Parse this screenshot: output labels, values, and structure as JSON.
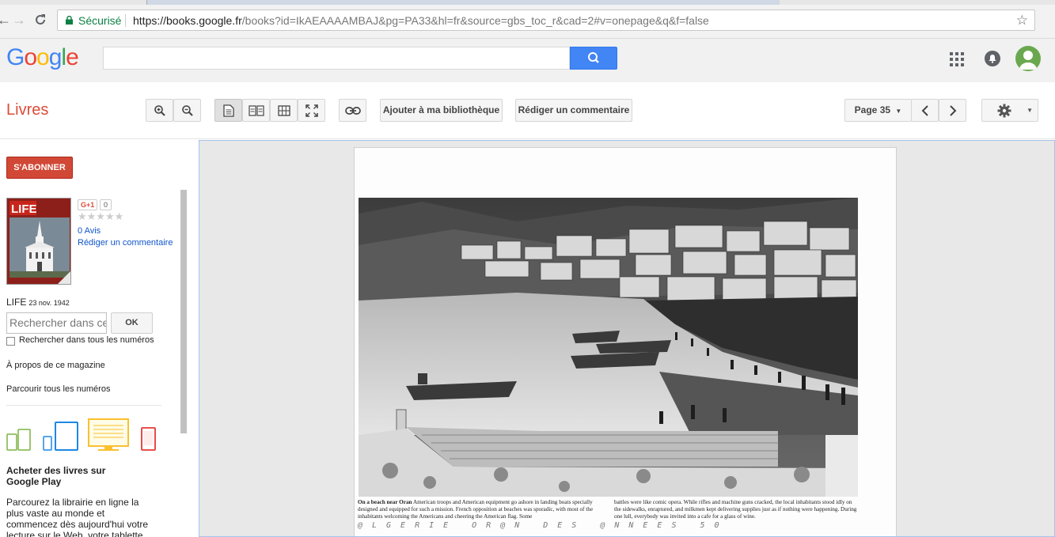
{
  "browser": {
    "secure_label": "Sécurisé",
    "url_host": "https://books.google.fr",
    "url_path": "/books?id=IkAEAAAAMBAJ&pg=PA33&hl=fr&source=gbs_toc_r&cad=2#v=onepage&q&f=false"
  },
  "google": {
    "logo": [
      "G",
      "o",
      "o",
      "g",
      "l",
      "e"
    ],
    "logo_colors": [
      "#4285f4",
      "#ea4335",
      "#fbbc05",
      "#4285f4",
      "#34a853",
      "#ea4335"
    ],
    "search_value": ""
  },
  "toolbar": {
    "section_title": "Livres",
    "add_library_label": "Ajouter à ma bibliothèque",
    "write_review_label": "Rédiger un commentaire",
    "page_label": "Page 35"
  },
  "sidebar": {
    "subscribe_label": "S'ABONNER",
    "cover_masthead": "LIFE",
    "gplus_label": "G+1",
    "gplus_count": "0",
    "stars": "★★★★★",
    "reviews_count": "0 Avis",
    "write_review_link": "Rédiger un commentaire",
    "magazine_title": "LIFE",
    "magazine_date": "23 nov. 1942",
    "search_placeholder": "Rechercher dans ce l",
    "ok_label": "OK",
    "search_all_label": "Rechercher dans tous les numéros",
    "about_link": "À propos de ce magazine",
    "browse_link": "Parcourir tous les numéros",
    "buy_title": "Acheter des livres sur Google Play",
    "buy_text": "Parcourez la librairie en ligne la plus vaste au monde et commencez dès aujourd'hui votre lecture sur le Web, votre tablette"
  },
  "viewer": {
    "caption_left_bold": "On a beach near Oran",
    "caption_left": " American troops and American equipment go ashore in landing boats specially designed and equipped for such a mission. French opposition at beaches was sporadic, with most of the inhabitants welcoming the Americans and cheering the American flag. Some",
    "caption_right": "battles were like comic opera. While rifles and machine guns cracked, the local inhabitants stood idly on the sidewalks, enraptured, and milkmen kept delivering supplies just as if nothing were happening. During one lull, everybody was invited into a cafe for a glass of wine.",
    "watermark": "@LGERIE OR@N DES @NNEES 50"
  },
  "colors": {
    "accent_red": "#dd4b39",
    "google_blue": "#4285f4",
    "link_blue": "#1155cc"
  }
}
